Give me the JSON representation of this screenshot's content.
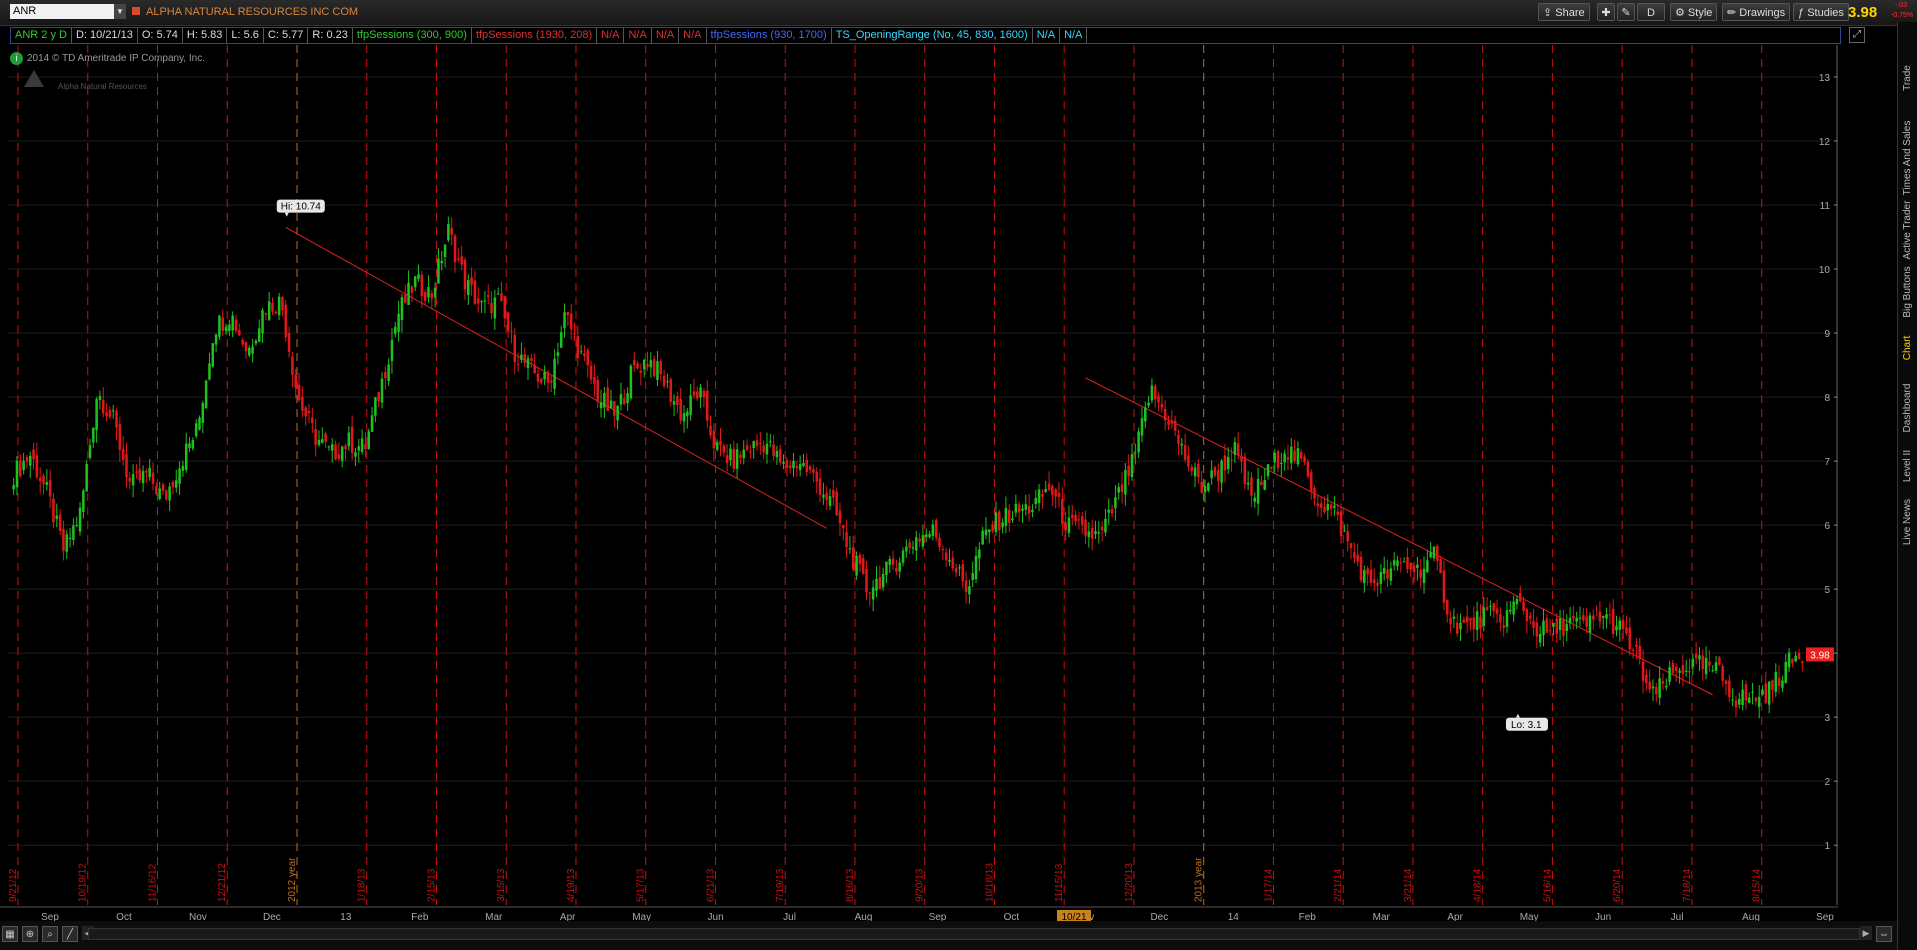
{
  "symbol": {
    "value": "ANR",
    "company": "ALPHA NATURAL RESOURCES INC COM"
  },
  "toolbar": {
    "share_label": "Share",
    "style_label": "Style",
    "drawings_label": "Drawings",
    "studies_label": "Studies",
    "d_label": "D",
    "last_price": "3.98",
    "change": "-.03",
    "change_pct": "-0.75%"
  },
  "infobar": {
    "series": "ANR 2 y D",
    "date": "D: 10/21/13",
    "open": "O: 5.74",
    "high": "H: 5.83",
    "low": "L: 5.6",
    "close": "C: 5.77",
    "range": "R: 0.23",
    "studies": [
      {
        "label": "tfpSessions (300, 900)",
        "color": "#2ecc2e"
      },
      {
        "label": "tfpSessions (1930, 208)",
        "color": "#e03030"
      },
      {
        "label": "N/A",
        "color": "#e03030"
      },
      {
        "label": "N/A",
        "color": "#e03030"
      },
      {
        "label": "N/A",
        "color": "#e03030"
      },
      {
        "label": "N/A",
        "color": "#e03030"
      },
      {
        "label": "tfpSessions (930, 1700)",
        "color": "#4466ff"
      },
      {
        "label": "TS_OpeningRange (No, 45, 830, 1600)",
        "color": "#3ad6ff"
      },
      {
        "label": "N/A",
        "color": "#3ad6ff"
      },
      {
        "label": "N/A",
        "color": "#3ad6ff"
      }
    ]
  },
  "copyright": "2014 © TD Ameritrade IP Company, Inc.",
  "logo_text": "Alpha Natural Resources",
  "colors": {
    "up": "#1ec21e",
    "down": "#e01818",
    "grid_red": "#cc1010",
    "grid_orange": "#c07020",
    "trend": "#e02020",
    "price_tag": "#e82020"
  },
  "chart_data": {
    "type": "candlestick",
    "y_ticks": [
      "13",
      "12",
      "11",
      "10",
      "9",
      "8",
      "7",
      "6",
      "5",
      "4",
      "3",
      "2",
      "1"
    ],
    "ylim": [
      0.3,
      13.5
    ],
    "month_labels": [
      "Sep",
      "Oct",
      "Nov",
      "Dec",
      "13",
      "Feb",
      "Mar",
      "Apr",
      "May",
      "Jun",
      "Jul",
      "Aug",
      "Sep",
      "Oct",
      "Nov",
      "Dec",
      "14",
      "Feb",
      "Mar",
      "Apr",
      "May",
      "Jun",
      "Jul",
      "Aug",
      "Sep"
    ],
    "session_labels": [
      "9/21/12",
      "10/19/12",
      "11/16/12",
      "12/21/12",
      "2012 year",
      "1/18/13",
      "2/15/13",
      "3/15/13",
      "4/19/13",
      "5/17/13",
      "6/21/13",
      "7/19/13",
      "8/16/13",
      "9/20/13",
      "10/18/13",
      "11/15/13",
      "12/20/13",
      "2013 year",
      "1/17/14",
      "2/21/14",
      "3/21/14",
      "4/18/14",
      "5/16/14",
      "6/20/14",
      "7/18/14",
      "8/15/14"
    ],
    "close_series": [
      6.8,
      7.1,
      6.5,
      5.6,
      6.2,
      8.1,
      7.6,
      6.6,
      6.8,
      6.4,
      7.0,
      7.5,
      9.1,
      9.3,
      8.7,
      9.4,
      9.5,
      8.0,
      7.4,
      7.1,
      7.3,
      7.2,
      8.2,
      9.3,
      9.8,
      9.6,
      10.6,
      9.8,
      9.4,
      9.5,
      8.7,
      8.4,
      8.2,
      9.3,
      8.6,
      8.0,
      7.7,
      8.4,
      8.6,
      8.2,
      7.7,
      8.1,
      7.2,
      7.0,
      7.2,
      7.3,
      6.9,
      7.0,
      6.7,
      6.3,
      5.6,
      5.0,
      5.2,
      5.5,
      5.8,
      5.9,
      5.5,
      5.0,
      5.8,
      6.1,
      6.2,
      6.3,
      6.6,
      6.0,
      5.9,
      5.8,
      6.4,
      7.0,
      8.1,
      7.7,
      7.1,
      6.6,
      6.8,
      7.2,
      6.4,
      6.8,
      7.2,
      7.0,
      6.4,
      6.2,
      5.6,
      5.1,
      5.2,
      5.4,
      5.3,
      5.5,
      4.5,
      4.4,
      4.6,
      4.5,
      4.8,
      4.4,
      4.3,
      4.5,
      4.4,
      4.6,
      4.4,
      4.0,
      3.3,
      3.6,
      3.8,
      3.8,
      3.7,
      3.3,
      3.3,
      3.4,
      3.8,
      4.0
    ],
    "high_label": "Hi: 10.74",
    "high_value": 10.74,
    "low_label": "Lo: 3.1",
    "low_value": 3.1,
    "current_label": "3.98",
    "current_value": 3.98,
    "cursor_date": "10/21"
  },
  "right_tabs": [
    "Trade",
    "Times And Sales",
    "Active Trader",
    "Big Buttons",
    "Chart",
    "Dashboard",
    "Level II",
    "Live News"
  ],
  "active_tab": "Chart"
}
